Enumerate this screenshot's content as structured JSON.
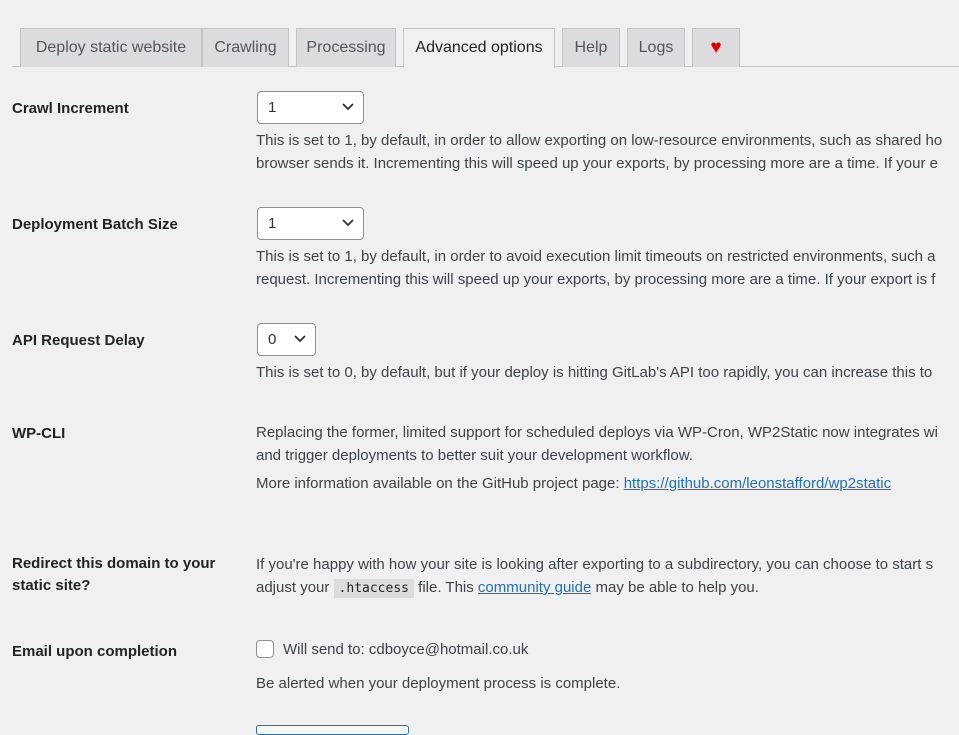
{
  "tabs": [
    {
      "label": "Deploy static website"
    },
    {
      "label": "Crawling"
    },
    {
      "label": "Processing"
    },
    {
      "label": "Advanced options"
    },
    {
      "label": "Help"
    },
    {
      "label": "Logs"
    },
    {
      "label": "♥"
    }
  ],
  "crawl_increment": {
    "label": "Crawl Increment",
    "value": "1",
    "desc_line1": "This is set to 1, by default, in order to allow exporting on low-resource environments, such as shared ho",
    "desc_line2": "browser sends it. Incrementing this will speed up your exports, by processing more are a time. If your e"
  },
  "deployment_batch": {
    "label": "Deployment Batch Size",
    "value": "1",
    "desc_line1": "This is set to 1, by default, in order to avoid execution limit timeouts on restricted environments, such a",
    "desc_line2": "request. Incrementing this will speed up your exports, by processing more are a time. If your export is f"
  },
  "api_delay": {
    "label": "API Request Delay",
    "value": "0",
    "desc": "This is set to 0, by default, but if your deploy is hitting GitLab's API too rapidly, you can increase this to"
  },
  "wpcli": {
    "label": "WP-CLI",
    "desc_line1": "Replacing the former, limited support for scheduled deploys via WP-Cron, WP2Static now integrates wi",
    "desc_line2": "and trigger deployments to better suit your development workflow.",
    "more_info": "More information available on the GitHub project page:",
    "link": "https://github.com/leonstafford/wp2static"
  },
  "redirect": {
    "label_line1": "Redirect this domain to your",
    "label_line2": "static site?",
    "desc_line1": "If you're happy with how your site is looking after exporting to a subdirectory, you can choose to start s",
    "desc_adjust": "adjust your",
    "code": ".htaccess",
    "desc_file": "file. This",
    "link": "community guide",
    "desc_end": "may be able to help you."
  },
  "email": {
    "label": "Email upon completion",
    "checkbox_label": "Will send to: cdboyce@hotmail.co.uk",
    "desc": "Be alerted when your deployment process is complete."
  },
  "icons": {
    "select_arrow": "chevron-down-icon",
    "heart": "heart-icon"
  },
  "colors": {
    "link": "#2271b1",
    "heart": "#e00000",
    "background": "#f0f0f1"
  }
}
